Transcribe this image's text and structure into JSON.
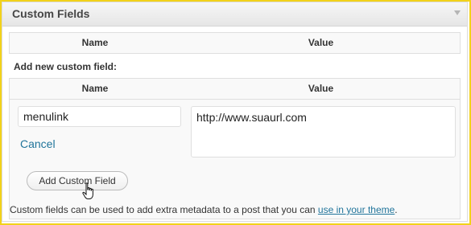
{
  "postbox": {
    "title": "Custom Fields",
    "toggle_icon": "triangle-down-icon"
  },
  "existing_table": {
    "columns": [
      "Name",
      "Value"
    ]
  },
  "new_field": {
    "heading": "Add new custom field:",
    "columns": [
      "Name",
      "Value"
    ],
    "key_value": "menulink",
    "value_text": "http://www.suaurl.com",
    "cancel_label": "Cancel",
    "add_button_label": "Add Custom Field"
  },
  "cursor_icon": "hand-pointer-icon",
  "footer": {
    "text_before": "Custom fields can be used to add extra metadata to a post that you can ",
    "link_text": "use in your theme",
    "text_after": "."
  },
  "colors": {
    "highlight_border": "#f2d21a",
    "link": "#21759b"
  }
}
